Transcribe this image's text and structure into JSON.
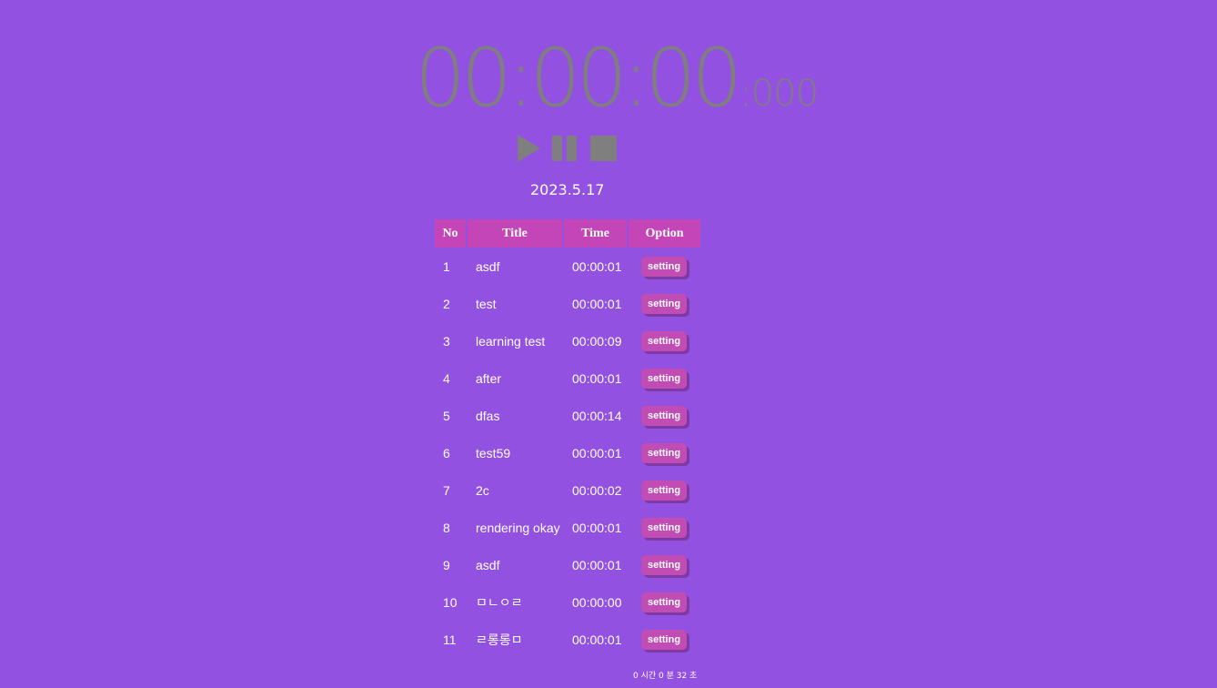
{
  "timer": {
    "main": "00:00:00",
    "ms": ":000"
  },
  "controls": {
    "play_icon": "play-icon",
    "pause_icon": "pause-icon",
    "stop_icon": "stop-icon",
    "icon_color": "#7f7f7f"
  },
  "date": "2023.5.17",
  "table": {
    "headers": [
      "No",
      "Title",
      "Time",
      "Option"
    ],
    "rows": [
      {
        "no": "1",
        "title": "asdf",
        "time": "00:00:01",
        "option": "setting"
      },
      {
        "no": "2",
        "title": "test",
        "time": "00:00:01",
        "option": "setting"
      },
      {
        "no": "3",
        "title": "learning test",
        "time": "00:00:09",
        "option": "setting"
      },
      {
        "no": "4",
        "title": "after",
        "time": "00:00:01",
        "option": "setting"
      },
      {
        "no": "5",
        "title": "dfas",
        "time": "00:00:14",
        "option": "setting"
      },
      {
        "no": "6",
        "title": "test59",
        "time": "00:00:01",
        "option": "setting"
      },
      {
        "no": "7",
        "title": "2c",
        "time": "00:00:02",
        "option": "setting"
      },
      {
        "no": "8",
        "title": "rendering okay",
        "time": "00:00:01",
        "option": "setting"
      },
      {
        "no": "9",
        "title": "asdf",
        "time": "00:00:01",
        "option": "setting"
      },
      {
        "no": "10",
        "title": "ㅁㄴㅇㄹ",
        "time": "00:00:00",
        "option": "setting"
      },
      {
        "no": "11",
        "title": "ㄹ롱롱ㅁ",
        "time": "00:00:01",
        "option": "setting"
      }
    ]
  },
  "total": "0 시간 0 분 32 초",
  "colors": {
    "background": "#9351e1",
    "header": "#c345b8",
    "button": "#c04cb4",
    "timer_text": "#7f7f7f"
  }
}
